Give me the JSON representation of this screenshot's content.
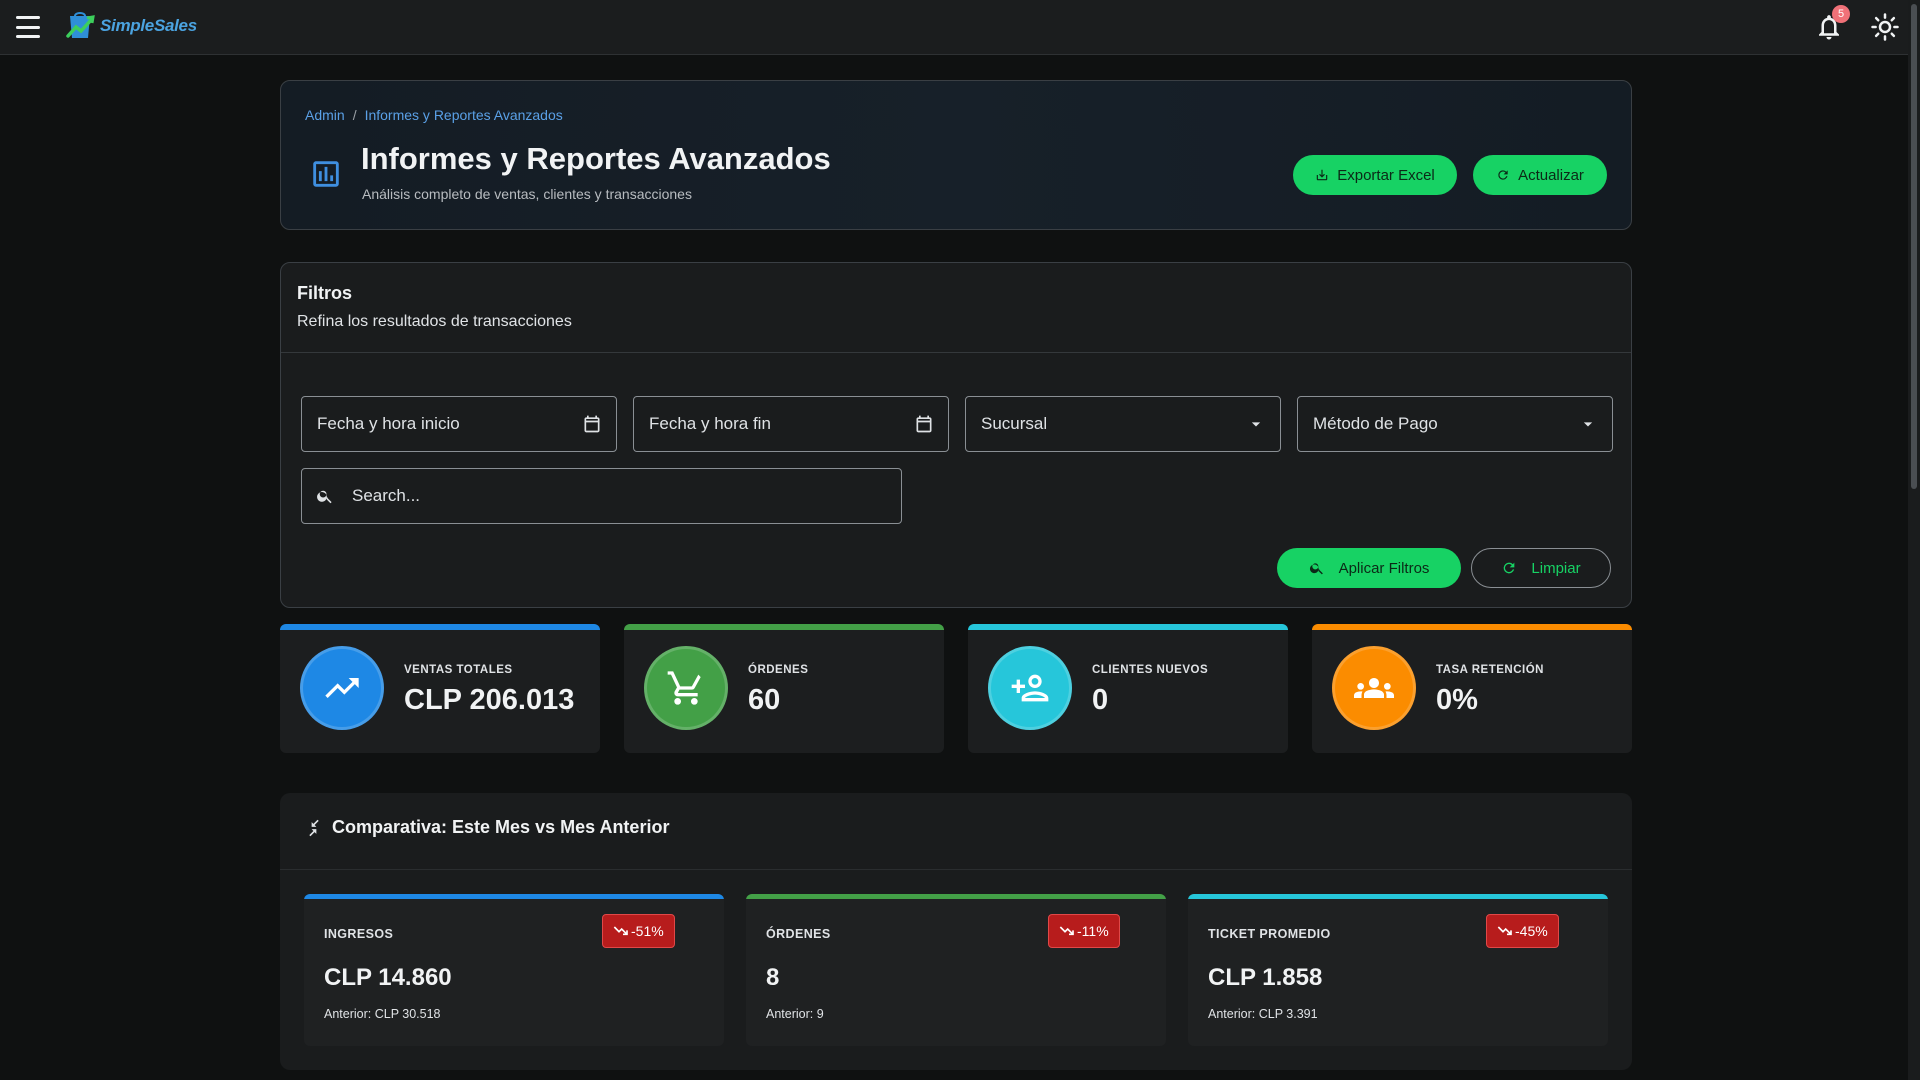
{
  "app": {
    "name": "SimpleSales",
    "notifications_count": "5"
  },
  "colors": {
    "accent": "#17d264",
    "blue": "#1e88e5",
    "green": "#43a047",
    "cyan": "#26c6da",
    "orange": "#fb8c00",
    "negative": "#b71c1c"
  },
  "breadcrumb": {
    "root": "Admin",
    "separator": "/",
    "current": "Informes y Reportes Avanzados"
  },
  "header": {
    "icon": "bar-chart-icon",
    "title": "Informes y Reportes Avanzados",
    "subtitle": "Análisis completo de ventas, clientes y transacciones",
    "export_label": "Exportar Excel",
    "refresh_label": "Actualizar"
  },
  "filters": {
    "title": "Filtros",
    "subtitle": "Refina los resultados de transacciones",
    "start_placeholder": "Fecha y hora inicio",
    "end_placeholder": "Fecha y hora fin",
    "branch_placeholder": "Sucursal",
    "payment_placeholder": "Método de Pago",
    "search_placeholder": "Search...",
    "apply_label": "Aplicar Filtros",
    "clear_label": "Limpiar"
  },
  "kpis": [
    {
      "label": "VENTAS TOTALES",
      "value": "CLP 206.013",
      "icon": "trending-up-icon",
      "color": "#1e88e5"
    },
    {
      "label": "ÓRDENES",
      "value": "60",
      "icon": "cart-icon",
      "color": "#43a047"
    },
    {
      "label": "CLIENTES NUEVOS",
      "value": "0",
      "icon": "person-add-icon",
      "color": "#26c6da"
    },
    {
      "label": "TASA RETENCIÓN",
      "value": "0%",
      "icon": "group-icon",
      "color": "#fb8c00"
    }
  ],
  "comparison": {
    "title": "Comparativa: Este Mes vs Mes Anterior",
    "icon": "compare-arrows-icon",
    "items": [
      {
        "label": "INGRESOS",
        "value": "CLP 14.860",
        "change": "-51%",
        "previous": "Anterior: CLP 30.518",
        "color": "#1e88e5"
      },
      {
        "label": "ÓRDENES",
        "value": "8",
        "change": "-11%",
        "previous": "Anterior: 9",
        "color": "#43a047"
      },
      {
        "label": "TICKET PROMEDIO",
        "value": "CLP 1.858",
        "change": "-45%",
        "previous": "Anterior: CLP 3.391",
        "color": "#26c6da"
      }
    ]
  }
}
